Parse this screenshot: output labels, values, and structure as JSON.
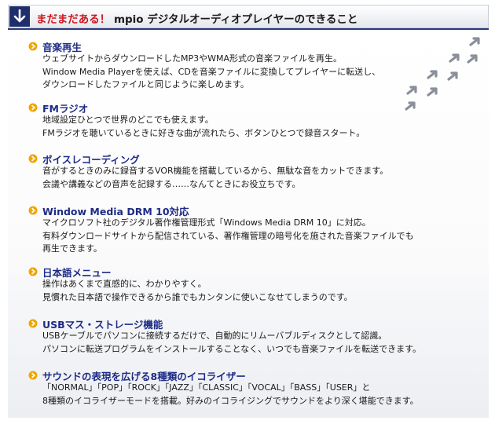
{
  "header": {
    "accent_text": "まだまだある！",
    "title_text": "mpio デジタルオーディオプレイヤーのできること",
    "icon": "arrow-down-icon"
  },
  "features": [
    {
      "title": "音楽再生",
      "lines": [
        "ウェブサイトからダウンロードしたMP3やWMA形式の音楽ファイルを再生。",
        "Window Media Playerを使えば、CDを音楽ファイルに変換してプレイヤーに転送し、",
        "ダウンロードしたファイルと同じように楽しめます。"
      ]
    },
    {
      "title": "FMラジオ",
      "lines": [
        "地域設定ひとつで世界のどこでも使えます。",
        "FMラジオを聴いているときに好きな曲が流れたら、ボタンひとつで録音スタート。"
      ]
    },
    {
      "title": "ボイスレコーディング",
      "lines": [
        "音がするときのみに録音するVOR機能を搭載しているから、無駄な音をカットできます。",
        "会議や講義などの音声を記録する……なんてときにお役立ちです。"
      ]
    },
    {
      "title": "Window Media DRM 10対応",
      "lines": [
        "マイクロソフト社のデジタル著作権管理形式「Windows Media DRM 10」に対応。",
        "有料ダウンロードサイトから配信されている、著作権管理の暗号化を施された音楽ファイルでも",
        "再生できます。"
      ]
    },
    {
      "title": "日本語メニュー",
      "lines": [
        "操作はあくまで直感的に、わかりやすく。",
        "見慣れた日本語で操作できるから誰でもカンタンに使いこなせてしまうのです。"
      ]
    },
    {
      "title": "USBマス・ストレージ機能",
      "lines": [
        "USBケーブルでパソコンに接続するだけで、自動的にリムーバブルディスクとして認識。",
        "パソコンに転送プログラムをインストールすることなく、いつでも音楽ファイルを転送できます。"
      ]
    },
    {
      "title": "サウンドの表現を広げる8種類のイコライザー",
      "lines": [
        "「NORMAL」「POP」「ROCK」「JAZZ」「CLASSIC」「VOCAL」「BASS」「USER」と",
        "8種類のイコライザーモードを搭載。好みのイコライジングでサウンドをより深く堪能できます。"
      ]
    }
  ],
  "decoration": {
    "icon": "arrow-trail-icon",
    "color": "#8a8f99"
  },
  "colors": {
    "accent": "#d0141a",
    "title": "#1d2b86",
    "bullet": "#f0a500",
    "header_icon_bg": "#1f2d6b"
  }
}
